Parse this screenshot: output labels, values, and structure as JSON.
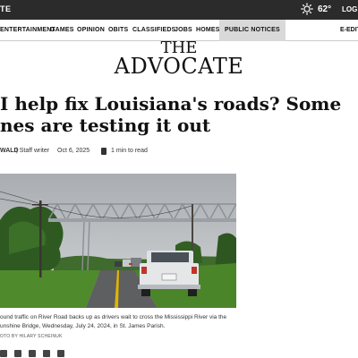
{
  "topbar": {
    "left_text": "TE",
    "temperature": "62°",
    "login_label": "LOG I"
  },
  "nav": {
    "items": [
      "ENTERTAINMENT",
      "GAMES",
      "OPINION",
      "OBITS",
      "CLASSIFIEDS",
      "JOBS",
      "HOMES",
      "PUBLIC NOTICES"
    ],
    "edition_label": "E-EDIT"
  },
  "masthead": {
    "the": "THE",
    "name": "ADVOCATE"
  },
  "article": {
    "headline_line1": "I help fix Louisiana's roads? Some",
    "headline_line2": "nes are testing it out",
    "author": "WALD",
    "role": " | Staff writer",
    "date": "Oct 6, 2025",
    "read_time": "1 min to read",
    "caption": "ound traffic on River Road backs up as drivers wait to cross the Mississippi River via the unshine Bridge, Wednesday, July 24, 2024, in St. James Parish.",
    "credit": "OTO BY HILARY SCHEINUK"
  },
  "colors": {
    "topbar_bg": "#2b2b2b",
    "active_nav_bg": "#d9d9d9",
    "sky": "#b9bcbf",
    "grass": "#4f8a2c",
    "road": "#5d5f60",
    "center_line": "#e2b400",
    "truck": "#dfe2e5"
  },
  "icons": [
    "sun-icon",
    "document-icon",
    "share-icon"
  ]
}
